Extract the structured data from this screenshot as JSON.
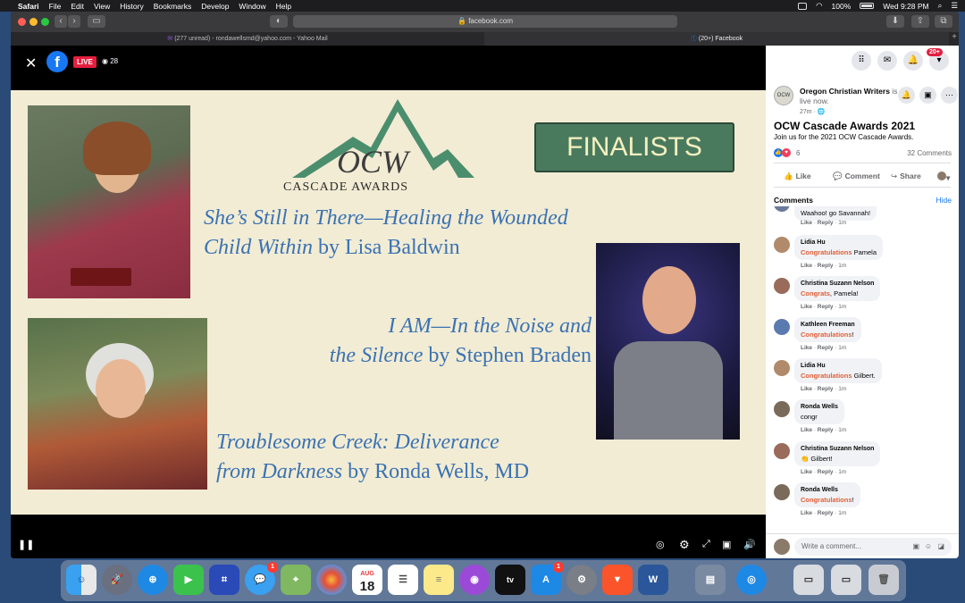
{
  "menubar": {
    "app": "Safari",
    "menus": [
      "File",
      "Edit",
      "View",
      "History",
      "Bookmarks",
      "Develop",
      "Window",
      "Help"
    ],
    "battery": "100%",
    "clock": "Wed 9:28 PM"
  },
  "browser": {
    "url": "facebook.com",
    "tabs": [
      {
        "label": "(277 unread) - rondawellsmd@yahoo.com - Yahoo Mail"
      },
      {
        "label": "(20+) Facebook"
      }
    ]
  },
  "video": {
    "live_label": "LIVE",
    "viewers": "28",
    "slide": {
      "logo_text": "CASCADE AWARDS",
      "logo_monogram": "OCW",
      "banner": "FINALISTS",
      "books": [
        {
          "title_line1": "She’s Still in There—Healing the Wounded",
          "title_line2": "Child Within",
          "byline": " by Lisa Baldwin"
        },
        {
          "title_line1": "I AM—In the Noise and",
          "title_line2": "the Silence",
          "byline": " by Stephen Braden"
        },
        {
          "title_line1": "Troublesome Creek: Deliverance",
          "title_line2": "from Darkness",
          "byline": " by Ronda Wells, MD"
        }
      ]
    }
  },
  "panel": {
    "notif_badge": "20+",
    "page_name": "Oregon Christian Writers",
    "page_status": " is live now.",
    "post_time": "27m · ",
    "title": "OCW Cascade Awards 2021",
    "subtitle": "Join us for the 2021 OCW Cascade Awards.",
    "reaction_count": "6",
    "comments_count": "32 Comments",
    "actions": {
      "like": "Like",
      "comment": "Comment",
      "share": "Share"
    },
    "comments_label": "Comments",
    "hide_label": "Hide",
    "comments": [
      {
        "name": "",
        "tag": "",
        "text": "Waahoo! go Savannah!",
        "time": "1m"
      },
      {
        "name": "Lidia Hu",
        "tag": "Congratulations",
        "text": " Pamela",
        "time": "1m"
      },
      {
        "name": "Christina Suzann Nelson",
        "tag": "Congrats",
        "text": ", Pamela!",
        "time": "1m"
      },
      {
        "name": "Kathleen Freeman",
        "tag": "Congratulations",
        "text": "!",
        "time": "1m"
      },
      {
        "name": "Lidia Hu",
        "tag": "Congratulations",
        "text": " Gilbert.",
        "time": "1m"
      },
      {
        "name": "Ronda Wells",
        "tag": "",
        "text": "congr",
        "time": "1m"
      },
      {
        "name": "Christina Suzann Nelson",
        "tag": "",
        "text": "👏 Gilbert!",
        "time": "1m"
      },
      {
        "name": "Ronda Wells",
        "tag": "Congratulations",
        "text": "!",
        "time": "1m"
      }
    ],
    "like_label": "Like",
    "reply_label": "Reply",
    "composer_placeholder": "Write a comment..."
  },
  "dock": {
    "calendar_month": "AUG",
    "calendar_day": "18",
    "messages_badge": "1",
    "appstore_badge": "1"
  }
}
